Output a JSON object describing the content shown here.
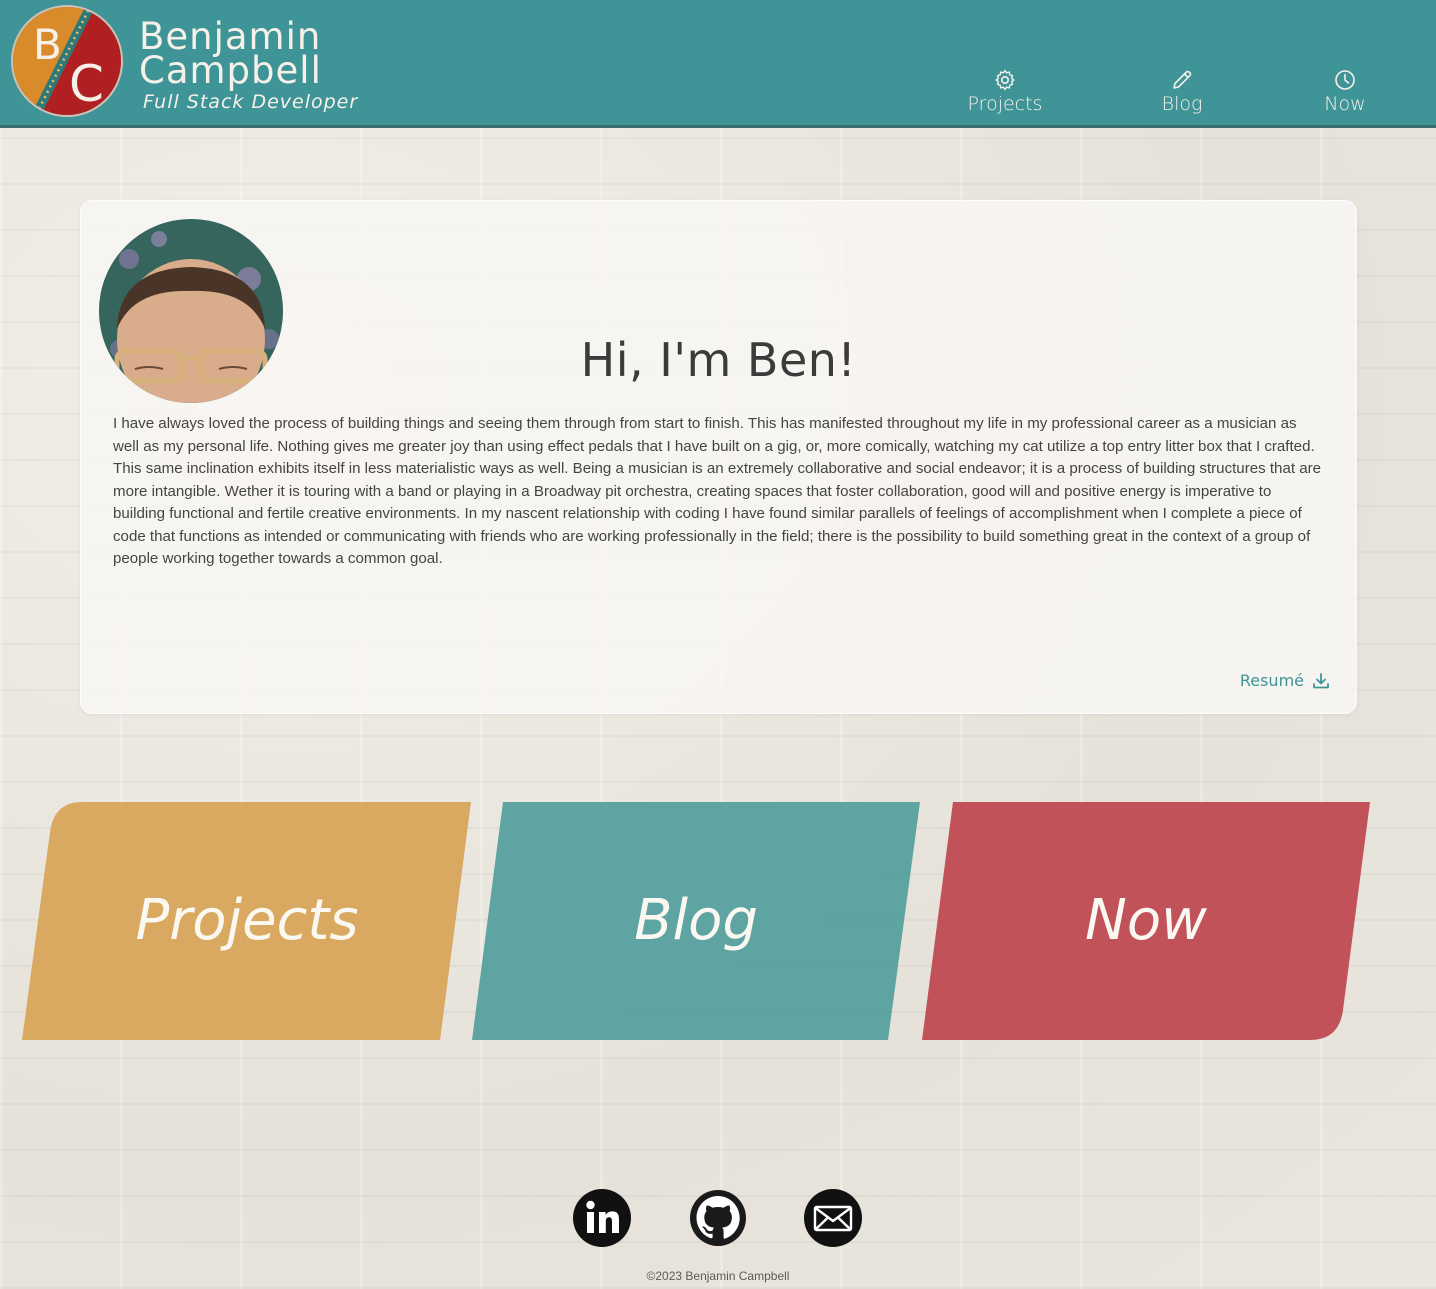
{
  "header": {
    "name_line1": "Benjamin",
    "name_line2": "Campbell",
    "tagline": "Full Stack Developer",
    "logo_letters": [
      "B",
      "C"
    ],
    "nav": [
      {
        "label": "Projects",
        "icon": "gear-icon"
      },
      {
        "label": "Blog",
        "icon": "pencil-icon"
      },
      {
        "label": "Now",
        "icon": "clock-icon"
      }
    ]
  },
  "about": {
    "greeting": "Hi, I'm Ben!",
    "bio": "I have always loved the process of building things and seeing them through from start to finish. This has manifested throughout my life in my professional career as a musician as well as my personal life. Nothing gives me greater joy than using effect pedals that I have built on a gig, or, more comically, watching my cat utilize a top entry litter box that I crafted. This same inclination exhibits itself in less materialistic ways as well. Being a musician is an extremely collaborative and social endeavor; it is a process of building structures that are more intangible. Wether it is touring with a band or playing in a Broadway pit orchestra, creating spaces that foster collaboration, good will and positive energy is imperative to building functional and fertile creative environments. In my nascent relationship with coding I have found similar parallels of feelings of accomplishment when I complete a piece of code that functions as intended or communicating with friends who are working professionally in the field; there is the possibility to build something great in the context of a group of people working together towards a common goal.",
    "resume_label": "Resumé"
  },
  "tiles": [
    {
      "label": "Projects",
      "color": "#d9a55a"
    },
    {
      "label": "Blog",
      "color": "#56a09e"
    },
    {
      "label": "Now",
      "color": "#bf4a52"
    }
  ],
  "social": [
    {
      "name": "LinkedIn",
      "icon": "linkedin-icon"
    },
    {
      "name": "GitHub",
      "icon": "github-icon"
    },
    {
      "name": "Email",
      "icon": "email-icon"
    }
  ],
  "footer": {
    "copyright": "©2023 Benjamin Campbell"
  },
  "colors": {
    "header_bg": "#3f9497",
    "accent": "#3f9497",
    "logo_orange": "#d98a2a",
    "logo_red": "#b01f22"
  }
}
